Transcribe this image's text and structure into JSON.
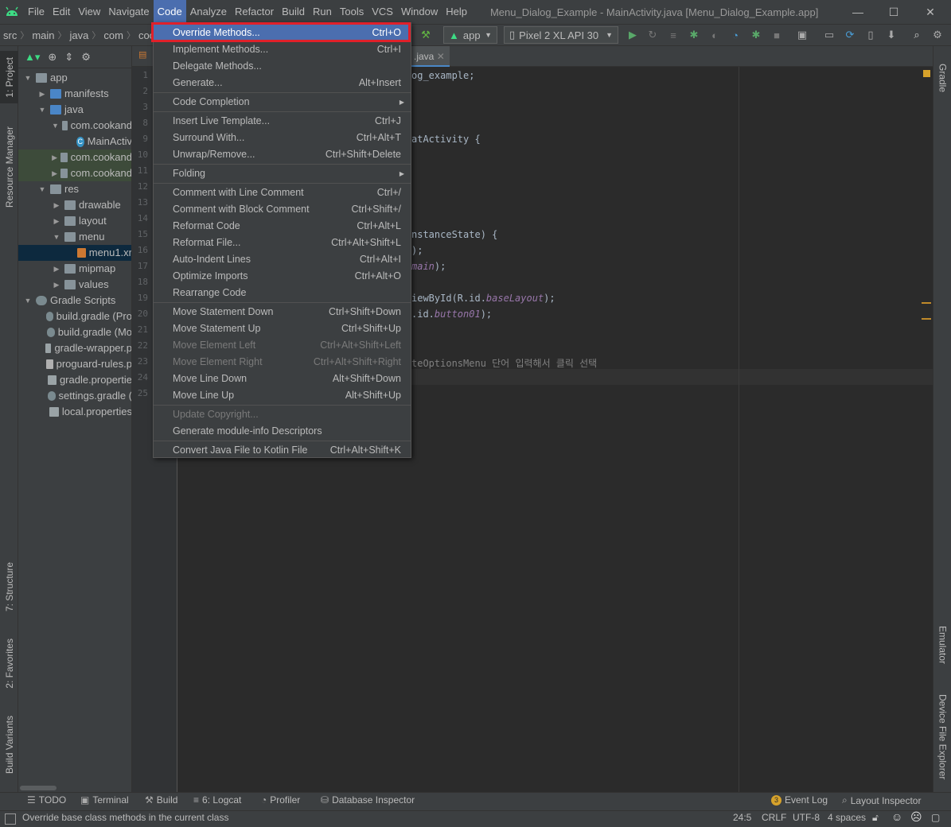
{
  "menubar": {
    "items": [
      "File",
      "Edit",
      "View",
      "Navigate",
      "Code",
      "Analyze",
      "Refactor",
      "Build",
      "Run",
      "Tools",
      "VCS",
      "Window",
      "Help"
    ],
    "window_title": "Menu_Dialog_Example - MainActivity.java [Menu_Dialog_Example.app]"
  },
  "window_controls": {
    "minimize": "—",
    "maximize": "☐",
    "close": "✕"
  },
  "breadcrumbs": [
    "src",
    "main",
    "java",
    "com",
    "cooka"
  ],
  "toolbar": {
    "run_config": "app",
    "device": "Pixel 2 XL API 30"
  },
  "left_tabs": [
    "1: Project",
    "Resource Manager",
    "7: Structure",
    "2: Favorites",
    "Build Variants"
  ],
  "right_tabs": [
    "Gradle",
    "Emulator",
    "Device File Explorer"
  ],
  "project_tree": [
    {
      "label": "app",
      "indent": 0,
      "arrow": "▼",
      "icon": "folder"
    },
    {
      "label": "manifests",
      "indent": 1,
      "arrow": "▶",
      "icon": "folder-blue"
    },
    {
      "label": "java",
      "indent": 1,
      "arrow": "▼",
      "icon": "folder-blue"
    },
    {
      "label": "com.cookand",
      "indent": 2,
      "arrow": "▼",
      "icon": "folder"
    },
    {
      "label": "MainActiv",
      "indent": 3,
      "arrow": "",
      "icon": "class"
    },
    {
      "label": "com.cookand",
      "indent": 2,
      "arrow": "▶",
      "icon": "folder"
    },
    {
      "label": "com.cookand",
      "indent": 2,
      "arrow": "▶",
      "icon": "folder"
    },
    {
      "label": "res",
      "indent": 1,
      "arrow": "▼",
      "icon": "folder"
    },
    {
      "label": "drawable",
      "indent": 2,
      "arrow": "▶",
      "icon": "folder"
    },
    {
      "label": "layout",
      "indent": 2,
      "arrow": "▶",
      "icon": "folder"
    },
    {
      "label": "menu",
      "indent": 2,
      "arrow": "▼",
      "icon": "folder"
    },
    {
      "label": "menu1.xr",
      "indent": 3,
      "arrow": "",
      "icon": "xml"
    },
    {
      "label": "mipmap",
      "indent": 2,
      "arrow": "▶",
      "icon": "folder"
    },
    {
      "label": "values",
      "indent": 2,
      "arrow": "▶",
      "icon": "folder"
    },
    {
      "label": "Gradle Scripts",
      "indent": 0,
      "arrow": "▼",
      "icon": "gradle"
    },
    {
      "label": "build.gradle (Pro",
      "indent": 1,
      "arrow": "",
      "icon": "gradle"
    },
    {
      "label": "build.gradle (Mo",
      "indent": 1,
      "arrow": "",
      "icon": "gradle"
    },
    {
      "label": "gradle-wrapper.p",
      "indent": 1,
      "arrow": "",
      "icon": "props"
    },
    {
      "label": "proguard-rules.p",
      "indent": 1,
      "arrow": "",
      "icon": "file"
    },
    {
      "label": "gradle.propertie",
      "indent": 1,
      "arrow": "",
      "icon": "props"
    },
    {
      "label": "settings.gradle (",
      "indent": 1,
      "arrow": "",
      "icon": "gradle"
    },
    {
      "label": "local.properties",
      "indent": 1,
      "arrow": "",
      "icon": "props"
    }
  ],
  "editor": {
    "tab_label": ".java",
    "line_numbers": [
      "1",
      "2",
      "3",
      "8",
      "9",
      "10",
      "11",
      "12",
      "13",
      "14",
      "15",
      "16",
      "17",
      "18",
      "19",
      "20",
      "21",
      "22",
      "23",
      "24",
      "25"
    ],
    "visible_code": [
      {
        "line_index": 0,
        "text": "og_example;"
      },
      {
        "line_index": 4,
        "text": "atActivity {"
      },
      {
        "line_index": 10,
        "text": "nstanceState) {"
      },
      {
        "line_index": 11,
        "text": ");"
      },
      {
        "line_index": 12,
        "text_plain": "",
        "text_italic": "main",
        "text_after": ");"
      },
      {
        "line_index": 14,
        "text_plain": "iewById(R.id.",
        "text_italic": "baseLayout",
        "text_after": ");"
      },
      {
        "line_index": 15,
        "text_plain": ".id.",
        "text_italic": "button01",
        "text_after": ");"
      },
      {
        "line_index": 18,
        "text": "teOptionsMenu 단어 입력해서 클릭 선택"
      }
    ]
  },
  "code_menu": {
    "items": [
      {
        "label": "Override Methods...",
        "shortcut": "Ctrl+O",
        "state": "hover"
      },
      {
        "label": "Implement Methods...",
        "shortcut": "Ctrl+I"
      },
      {
        "label": "Delegate Methods...",
        "shortcut": ""
      },
      {
        "label": "Generate...",
        "shortcut": "Alt+Insert"
      },
      {
        "sep": true
      },
      {
        "label": "Code Completion",
        "shortcut": "",
        "submenu": true
      },
      {
        "sep": true
      },
      {
        "label": "Insert Live Template...",
        "shortcut": "Ctrl+J"
      },
      {
        "label": "Surround With...",
        "shortcut": "Ctrl+Alt+T"
      },
      {
        "label": "Unwrap/Remove...",
        "shortcut": "Ctrl+Shift+Delete"
      },
      {
        "sep": true
      },
      {
        "label": "Folding",
        "shortcut": "",
        "submenu": true
      },
      {
        "sep": true
      },
      {
        "label": "Comment with Line Comment",
        "shortcut": "Ctrl+/"
      },
      {
        "label": "Comment with Block Comment",
        "shortcut": "Ctrl+Shift+/"
      },
      {
        "label": "Reformat Code",
        "shortcut": "Ctrl+Alt+L"
      },
      {
        "label": "Reformat File...",
        "shortcut": "Ctrl+Alt+Shift+L"
      },
      {
        "label": "Auto-Indent Lines",
        "shortcut": "Ctrl+Alt+I"
      },
      {
        "label": "Optimize Imports",
        "shortcut": "Ctrl+Alt+O"
      },
      {
        "label": "Rearrange Code",
        "shortcut": ""
      },
      {
        "sep": true
      },
      {
        "label": "Move Statement Down",
        "shortcut": "Ctrl+Shift+Down"
      },
      {
        "label": "Move Statement Up",
        "shortcut": "Ctrl+Shift+Up"
      },
      {
        "label": "Move Element Left",
        "shortcut": "Ctrl+Alt+Shift+Left",
        "disabled": true
      },
      {
        "label": "Move Element Right",
        "shortcut": "Ctrl+Alt+Shift+Right",
        "disabled": true
      },
      {
        "label": "Move Line Down",
        "shortcut": "Alt+Shift+Down"
      },
      {
        "label": "Move Line Up",
        "shortcut": "Alt+Shift+Up"
      },
      {
        "sep": true
      },
      {
        "label": "Update Copyright...",
        "shortcut": "",
        "disabled": true
      },
      {
        "label": "Generate module-info Descriptors",
        "shortcut": ""
      },
      {
        "sep": true
      },
      {
        "label": "Convert Java File to Kotlin File",
        "shortcut": "Ctrl+Alt+Shift+K"
      }
    ]
  },
  "bottom_tools": {
    "todo": "TODO",
    "terminal": "Terminal",
    "build": "Build",
    "logcat": "6: Logcat",
    "profiler": "Profiler",
    "database": "Database Inspector",
    "event_log": "Event Log",
    "event_count": "3",
    "layout_inspector": "Layout Inspector"
  },
  "status_bar": {
    "message": "Override base class methods in the current class",
    "position": "24:5",
    "line_sep": "CRLF",
    "encoding": "UTF-8",
    "indent": "4 spaces"
  },
  "colors": {
    "accent": "#4b6eaf",
    "highlight_box": "#e0202a",
    "bg": "#2b2b2b",
    "panel": "#3c3f41"
  }
}
